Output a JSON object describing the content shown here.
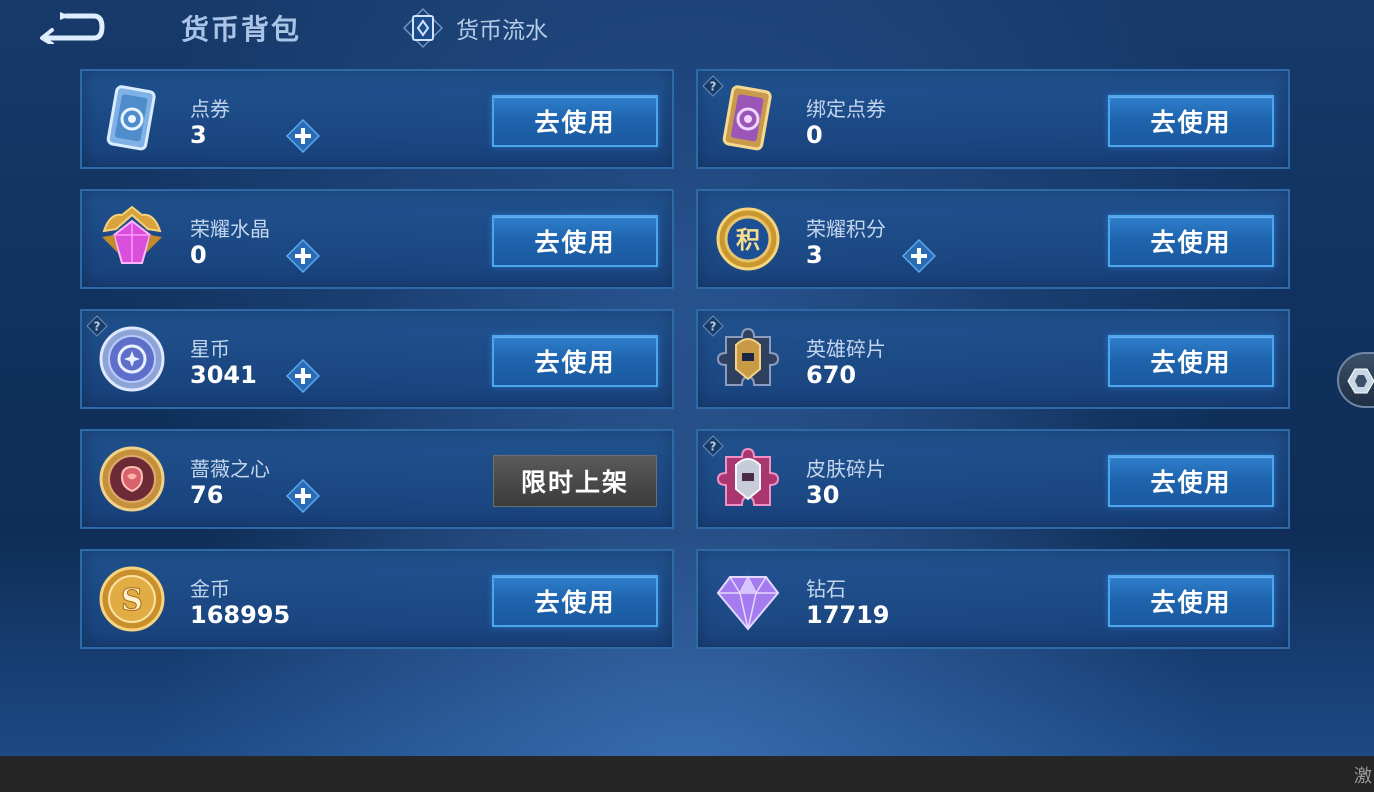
{
  "header": {
    "title": "货币背包",
    "flow_tab_label": "货币流水"
  },
  "currencies": [
    {
      "name": "点券",
      "count": "3",
      "button": "去使用",
      "plus": true,
      "help": false,
      "icon": "coupon-ticket-icon"
    },
    {
      "name": "绑定点券",
      "count": "0",
      "button": "去使用",
      "plus": false,
      "help": true,
      "icon": "bound-coupon-ticket-icon"
    },
    {
      "name": "荣耀水晶",
      "count": "0",
      "button": "去使用",
      "plus": true,
      "help": false,
      "icon": "glory-crystal-icon"
    },
    {
      "name": "荣耀积分",
      "count": "3",
      "button": "去使用",
      "plus": true,
      "help": false,
      "icon": "glory-points-icon"
    },
    {
      "name": "星币",
      "count": "3041",
      "button": "去使用",
      "plus": true,
      "help": true,
      "icon": "star-coin-icon"
    },
    {
      "name": "英雄碎片",
      "count": "670",
      "button": "去使用",
      "plus": false,
      "help": true,
      "icon": "hero-fragment-icon"
    },
    {
      "name": "蔷薇之心",
      "count": "76",
      "button": "限时上架",
      "plus": true,
      "help": false,
      "icon": "rose-heart-icon"
    },
    {
      "name": "皮肤碎片",
      "count": "30",
      "button": "去使用",
      "plus": false,
      "help": true,
      "icon": "skin-fragment-icon"
    },
    {
      "name": "金币",
      "count": "168995",
      "button": "去使用",
      "plus": false,
      "help": false,
      "icon": "gold-coin-icon"
    },
    {
      "name": "钻石",
      "count": "17719",
      "button": "去使用",
      "plus": false,
      "help": false,
      "icon": "diamond-icon"
    }
  ],
  "corner_text": "激",
  "colors": {
    "background": "#11325f",
    "card": "#1f4f8c",
    "card_border": "#2f6aa8",
    "use_button": "#1e63ad",
    "use_button_border": "#4aa6ee",
    "limited_button": "#4a4a4a"
  }
}
